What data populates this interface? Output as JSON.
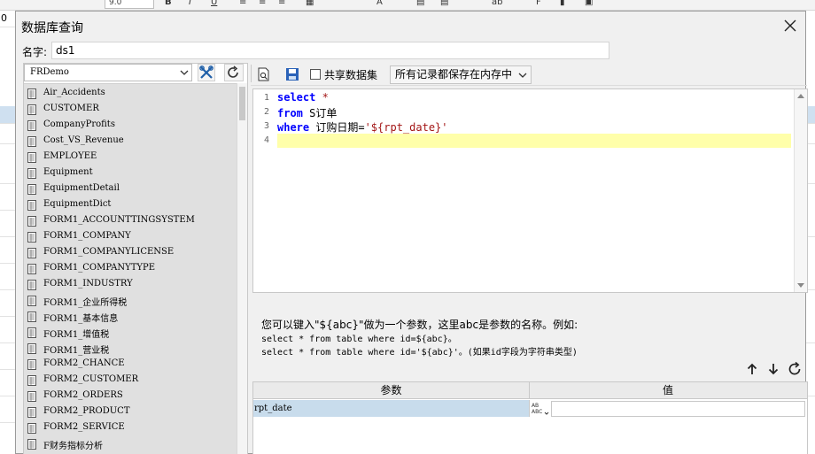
{
  "background_app": {
    "font_size_value": "9.0",
    "left_column_label": "0"
  },
  "dialog": {
    "title": "数据库查询",
    "name_label": "名字:",
    "name_value": "ds1",
    "datasource": {
      "selected": "FRDemo"
    },
    "tables": [
      "Air_Accidents",
      "CUSTOMER",
      "CompanyProfits",
      "Cost_VS_Revenue",
      "EMPLOYEE",
      "Equipment",
      "EquipmentDetail",
      "EquipmentDict",
      "FORM1_ACCOUNTTINGSYSTEM",
      "FORM1_COMPANY",
      "FORM1_COMPANYLICENSE",
      "FORM1_COMPANYTYPE",
      "FORM1_INDUSTRY",
      "FORM1_企业所得税",
      "FORM1_基本信息",
      "FORM1_增值税",
      "FORM1_营业税",
      "FORM2_CHANCE",
      "FORM2_CUSTOMER",
      "FORM2_ORDERS",
      "FORM2_PRODUCT",
      "FORM2_SERVICE",
      "F财务指标分析"
    ],
    "toolbar": {
      "share_label": "共享数据集",
      "share_checked": false,
      "memory_mode": "所有记录都保存在内存中"
    },
    "sql": {
      "line_numbers": [
        "1",
        "2",
        "3",
        "4"
      ],
      "line1_kw": "select",
      "line1_rest": " *",
      "line2_kw": "from",
      "line2_rest": " S订单",
      "line3_kw": "where",
      "line3_rest": " 订购日期=",
      "line3_str": "'${rpt_date}'"
    },
    "hint": {
      "line1": "您可以键入\"${abc}\"做为一个参数，这里abc是参数的名称。例如:",
      "line2": "select * from table where id=${abc}。",
      "line3": "select * from table where id='${abc}'。(如果id字段为字符串类型)"
    },
    "params_table": {
      "header_param": "参数",
      "header_value": "值",
      "rows": [
        {
          "name": "rpt_date",
          "value": ""
        }
      ]
    }
  }
}
